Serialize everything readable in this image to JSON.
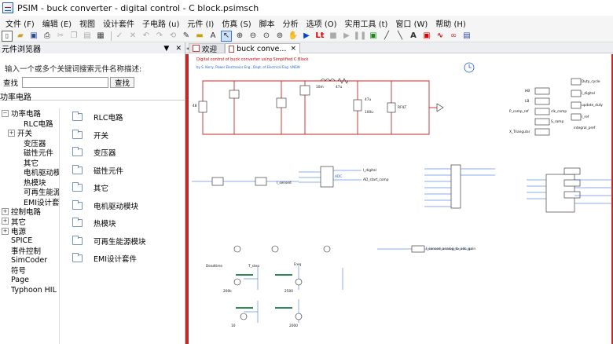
{
  "window": {
    "title": "PSIM - buck converter - digital control - C block.psimsch"
  },
  "menu": [
    "文件 (F)",
    "编辑 (E)",
    "视图",
    "设计套件",
    "子电路 (u)",
    "元件 (I)",
    "仿真 (S)",
    "脚本",
    "分析",
    "选项 (O)",
    "实用工具 (t)",
    "窗口 (W)",
    "帮助 (H)"
  ],
  "library": {
    "header": "元件浏览器",
    "search_hint": "输入一个或多个关键词搜索元件名称描述:",
    "search_label": "查找",
    "search_placeholder": "",
    "search_button": "查找",
    "title": "功率电路",
    "tree": [
      {
        "label": "功率电路",
        "indent": 0,
        "exp": "⊟"
      },
      {
        "label": "RLC电路",
        "indent": 2,
        "exp": ""
      },
      {
        "label": "开关",
        "indent": 1,
        "exp": "⊞"
      },
      {
        "label": "变压器",
        "indent": 2,
        "exp": ""
      },
      {
        "label": "磁性元件",
        "indent": 2,
        "exp": ""
      },
      {
        "label": "其它",
        "indent": 2,
        "exp": ""
      },
      {
        "label": "电机驱动模块",
        "indent": 2,
        "exp": ""
      },
      {
        "label": "热模块",
        "indent": 2,
        "exp": ""
      },
      {
        "label": "可再生能源模块",
        "indent": 2,
        "exp": ""
      },
      {
        "label": "EMI设计套件",
        "indent": 2,
        "exp": ""
      },
      {
        "label": "控制电路",
        "indent": 0,
        "exp": "⊞"
      },
      {
        "label": "其它",
        "indent": 0,
        "exp": "⊞"
      },
      {
        "label": "电源",
        "indent": 0,
        "exp": "⊞"
      },
      {
        "label": "SPICE",
        "indent": 0,
        "exp": ""
      },
      {
        "label": "事件控制",
        "indent": 0,
        "exp": ""
      },
      {
        "label": "SimCoder",
        "indent": 0,
        "exp": ""
      },
      {
        "label": "符号",
        "indent": 0,
        "exp": ""
      },
      {
        "label": "Page",
        "indent": 0,
        "exp": ""
      },
      {
        "label": "Typhoon HIL",
        "indent": 0,
        "exp": ""
      }
    ],
    "items": [
      "RLC电路",
      "开关",
      "变压器",
      "磁性元件",
      "其它",
      "电机驱动模块",
      "热模块",
      "可再生能源模块",
      "EMI设计套件"
    ]
  },
  "tabs": [
    {
      "label": "欢迎"
    },
    {
      "label": "buck conve...",
      "close": "×"
    }
  ],
  "schematic": {
    "title": "Digital control of buck converter using Simplified C Block",
    "subtitle": "by S. Kerry, Power Electronics Eng., Dept. of Electrical Eng. UNSW",
    "labels": {
      "vin": "48",
      "l1": "10m",
      "l2": "47u",
      "c1": "47u",
      "r_load": "10m",
      "r2": "100u",
      "rload2": "RFILT",
      "hb": "HB",
      "lb": "LB",
      "p_comp": "P_comp_ref",
      "clk": "clk_comp",
      "ramp": "S_ramp",
      "x_triang": "X_Triangular",
      "duty": "Duty_cycle",
      "i_digital": "I_digital",
      "update": "update_duty",
      "i_ref": "I_ref",
      "int_pref": "integral_pref",
      "adc": "ADC",
      "i_sensed": "I_sensed",
      "i_digital2": "I_digital",
      "ad_start": "AD_start_comp",
      "deadtime": "Deadtime",
      "t_step": "T_step",
      "freq": "Freq",
      "v200k": "200k",
      "v2500": "2500",
      "v10": "10",
      "v2000": "2000",
      "sensed_gain": "I_sensed_analog_to_adc_gain"
    }
  }
}
